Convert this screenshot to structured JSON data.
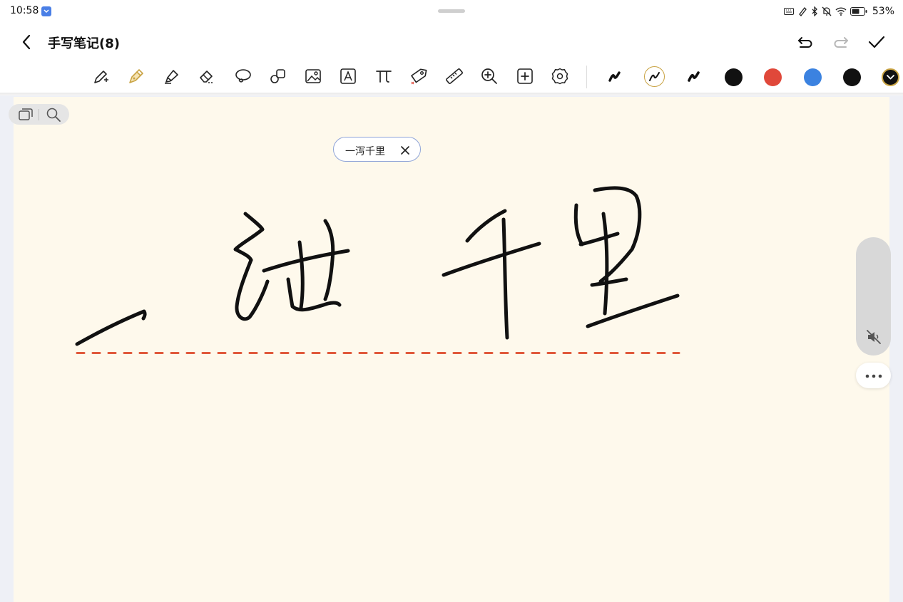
{
  "status_bar": {
    "time": "10:58",
    "battery": "53%",
    "icons": [
      "app-notification-icon",
      "keyboard-icon",
      "stylus-icon",
      "bluetooth-icon",
      "silent-icon",
      "wifi-icon",
      "battery-icon"
    ]
  },
  "header": {
    "title": "手写笔记(8)",
    "back_icon": "chevron-left-icon",
    "actions": [
      "undo-icon",
      "redo-icon",
      "check-icon"
    ]
  },
  "toolbar": {
    "tools": [
      "magic-pen-icon",
      "fountain-pen-icon",
      "highlighter-icon",
      "eraser-icon",
      "lasso-icon",
      "shapes-icon",
      "image-icon",
      "text-box-icon",
      "math-pi-icon",
      "tag-icon",
      "ruler-icon",
      "zoom-in-icon",
      "add-icon",
      "settings-icon"
    ],
    "pen_styles": [
      "pen-style-1",
      "pen-style-2",
      "pen-style-3"
    ],
    "selected_tool": "fountain-pen-icon",
    "selected_pen_style": "pen-style-2",
    "colors": [
      "#111111",
      "#e0483a",
      "#3b82e0",
      "#111111"
    ]
  },
  "canvas": {
    "background": "#fef9ec",
    "suggestion": {
      "text": "一泻千里",
      "close_icon": "close-icon"
    },
    "underline_color": "#e05a3c"
  },
  "mini_toolbar": [
    "pages-icon",
    "search-icon"
  ],
  "side_panel": {
    "mute_icon": "speaker-muted-icon",
    "more_icon": "more-horizontal-icon"
  }
}
